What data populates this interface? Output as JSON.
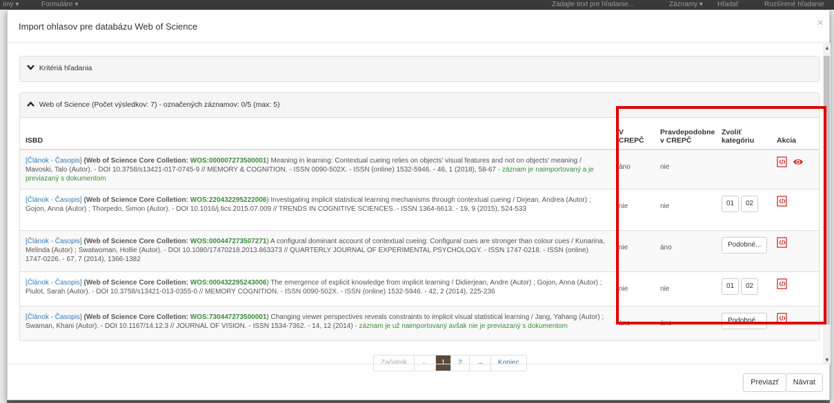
{
  "background": {
    "top_items": [
      "imy ▾",
      "Formuláre ▾",
      "Zadajte text pre hľadanie...",
      "Záznamy ▾",
      "Hľadať",
      "Rozšírené hľadanie"
    ]
  },
  "modal": {
    "title": "Import ohlasov pre databázu Web of Science",
    "close": "×",
    "criteria_panel": {
      "title": "Kritériá hľadania"
    },
    "results_panel": {
      "title": "Web of Science (Počet výsledkov: 7) - označených záznamov: 0/5 (max: 5)"
    },
    "table": {
      "headers": {
        "isbd": "ISBD",
        "in_crepc": "V CREPČ",
        "probably_line1": "Pravdepodobne",
        "probably_line2": "v CREPČ",
        "category_line1": "Zvoliť",
        "category_line2": "kategóriu",
        "action": "Akcia"
      },
      "rows": [
        {
          "type": "[Článok - Časopis]",
          "source": "(Web of Science Core Colletion:",
          "wos": "WOS:000007273500001",
          "text": ") Meaning in learning: Contextual cueing relies on objects' visual features and not on objects' meaning / Mavoski, Talo (Autor). - DOI 10.3758/s13421-017-0745-9 // MEMORY & COGNITION. - ISSN 0090-502X. - ISSN (online) 1532-5946. - 46, 1 (2018), 58-67",
          "note": " - záznam je naimportovaný a je previazaný s dokumentom",
          "in_crepc": "áno",
          "probably": "nie",
          "category": null,
          "actions": [
            "xml-icon",
            "eye-icon"
          ]
        },
        {
          "type": "[Článok - Časopis]",
          "source": "(Web of Science Core Colletion:",
          "wos": "WOS:220432295222006",
          "text": ") Investigating implicit statistical learning mechanisms through contextual cueing / Dirjean, Andrea (Autor) ; Gojon, Anna (Autor) ; Thorpedo, Simon (Autor). - DOI 10.1016/j.tics.2015.07.009 // TRENDS IN COGNITIVE SCIENCES. - ISSN 1364-6613. - 19, 9 (2015), 524-533",
          "note": "",
          "in_crepc": "nie",
          "probably": "nie",
          "category": [
            "01",
            "02"
          ],
          "actions": [
            "xml-icon"
          ]
        },
        {
          "type": "[Článok - Časopis]",
          "source": "(Web of Science Core Colletion:",
          "wos": "WOS:000447273507271",
          "text": ") A configural dominant account of contextual cueing: Configural cues are stronger than colour cues / Kunarina, Melinda (Autor) ; Swatwoman, Hollie (Autor). - DOI 10.1080/17470218.2013.863373 // QUARTERLY JOURNAL OF EXPERIMENTAL PSYCHOLOGY. - ISSN 1747-0218. - ISSN (online) 1747-0226. - 67, 7 (2014), 1366-1382",
          "note": "",
          "in_crepc": "nie",
          "probably": "áno",
          "category": "Podobné...",
          "actions": [
            "xml-icon"
          ]
        },
        {
          "type": "[Článok - Časopis]",
          "source": "(Web of Science Core Colletion:",
          "wos": "WOS:000432295243006",
          "text": ") The emergence of explicit knowledge from implicit learning / Didierjean, Andre (Autor) ; Gojon, Anna (Autor) ; Piulot, Sarah (Autor). - DOI 10.3758/s13421-013-0355-0 // MEMORY COGNITION. - ISSN 0090-502X. - ISSN (online) 1532-5946. - 42, 2 (2014), 225-236",
          "note": "",
          "in_crepc": "nie",
          "probably": "nie",
          "category": [
            "01",
            "02"
          ],
          "actions": [
            "xml-icon"
          ]
        },
        {
          "type": "[Článok - Časopis]",
          "source": "(Web of Science Core Colletion:",
          "wos": "WOS:730447273500001",
          "text": ") Changing viewer perspectives reveals constraints to implicit visual statistical learning / Jang, Yahang (Autor) ; Swaman, Khani (Autor). - DOI 10.1167/14.12.3 // JOURNAL OF VISION. - ISSN 1534-7362. - 14, 12 (2014)",
          "note": " - záznam je už naimportovaný avšak nie je previazaný s dokumentom",
          "in_crepc": "áno",
          "probably": "áno",
          "category": "Podobné...",
          "actions": [
            "xml-icon"
          ]
        }
      ]
    },
    "pagination": {
      "first": "Začiatok",
      "prev": "←",
      "pages": [
        "1",
        "2"
      ],
      "current_page": "1",
      "next": "→",
      "last": "Koniec"
    },
    "footer": {
      "transfer": "Previazť",
      "back": "Návrat"
    }
  },
  "colors": {
    "highlight": "#e00000",
    "wos_green": "#3c8a3c",
    "link_blue": "#337ab7",
    "active_page": "#5a4a3a"
  }
}
